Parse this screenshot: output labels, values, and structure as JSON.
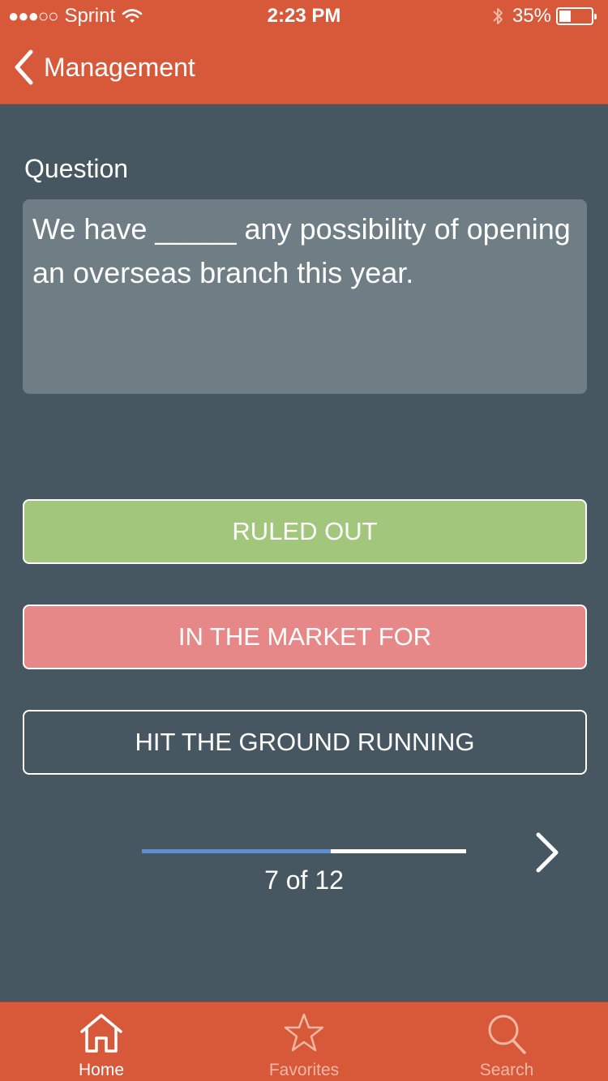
{
  "status_bar": {
    "signal": "●●●○○",
    "carrier": "Sprint",
    "time": "2:23 PM",
    "battery_pct": "35%",
    "battery_level": 0.35
  },
  "nav": {
    "back_label": "Management"
  },
  "question": {
    "label": "Question",
    "text": "We have _____ any possibility of opening an overseas branch this year."
  },
  "answers": [
    {
      "label": "RULED OUT",
      "state": "correct",
      "color": "#a2c67b"
    },
    {
      "label": "IN THE MARKET FOR",
      "state": "incorrect",
      "color": "#e68888"
    },
    {
      "label": "HIT THE GROUND RUNNING",
      "state": "neutral",
      "color": "transparent"
    }
  ],
  "progress": {
    "text": "7 of 12",
    "current": 7,
    "total": 12
  },
  "tabs": [
    {
      "label": "Home",
      "icon": "home-icon",
      "active": true
    },
    {
      "label": "Favorites",
      "icon": "star-icon",
      "active": false
    },
    {
      "label": "Search",
      "icon": "search-icon",
      "active": false
    }
  ],
  "colors": {
    "accent": "#d8593a",
    "background": "#465762",
    "progress": "#5b8fd0"
  }
}
